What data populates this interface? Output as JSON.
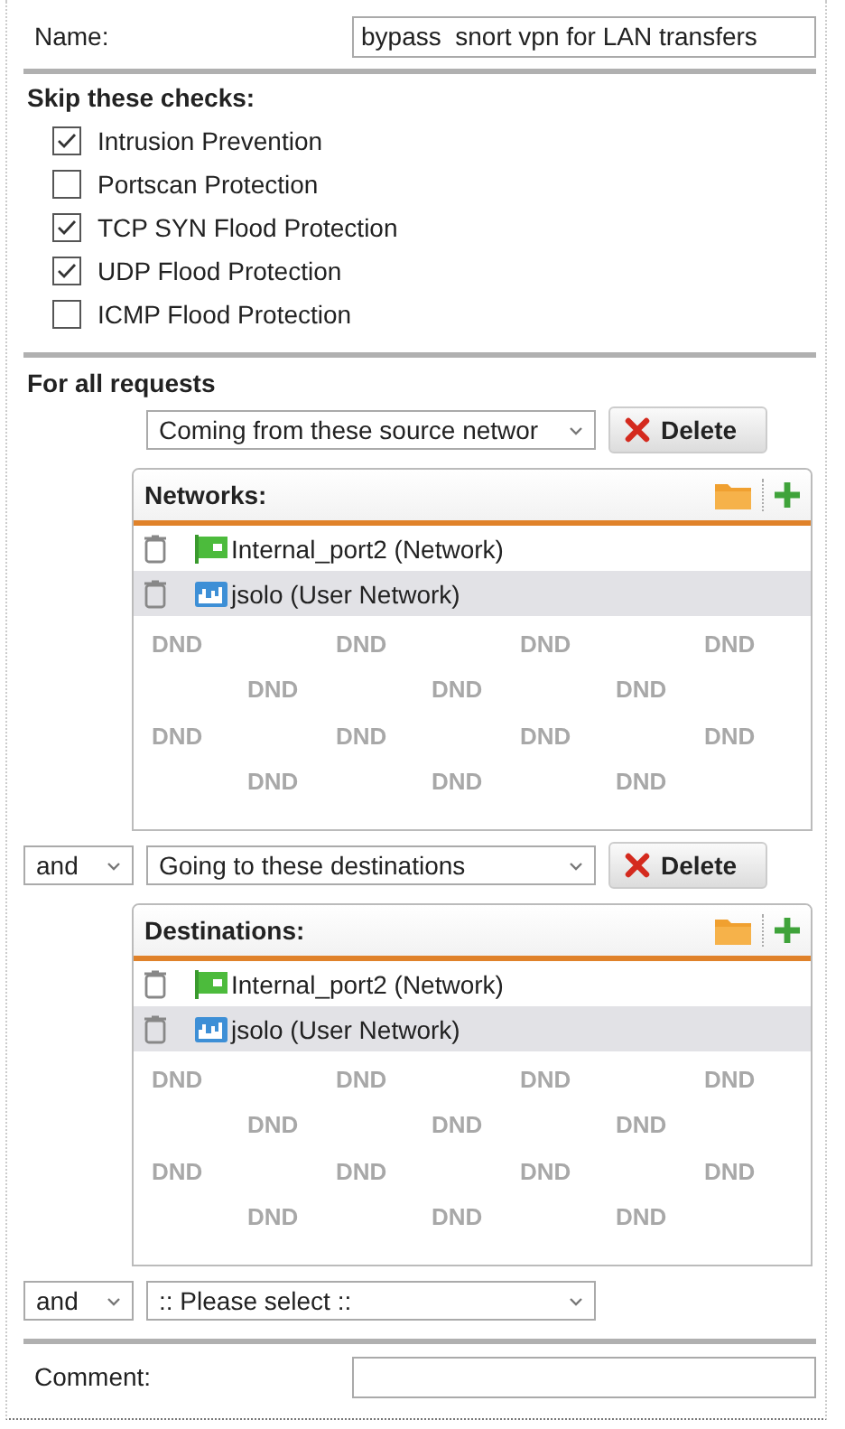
{
  "name_field": {
    "label": "Name:",
    "value": "bypass  snort vpn for LAN transfers"
  },
  "skip_checks": {
    "heading": "Skip these checks:",
    "items": [
      {
        "label": "Intrusion Prevention",
        "checked": true
      },
      {
        "label": "Portscan Protection",
        "checked": false
      },
      {
        "label": "TCP SYN Flood Protection",
        "checked": true
      },
      {
        "label": "UDP Flood Protection",
        "checked": true
      },
      {
        "label": "ICMP Flood Protection",
        "checked": false
      }
    ]
  },
  "requests": {
    "heading": "For all requests",
    "conditions": [
      {
        "kind": "list",
        "condition": "Coming from these source networ",
        "delete": "Delete",
        "list_title": "Networks:",
        "entries": [
          {
            "label": "Internal_port2 (Network)",
            "kind": "network",
            "selected": false
          },
          {
            "label": "jsolo (User Network)",
            "kind": "user",
            "selected": true
          }
        ],
        "drop_hints": [
          "DND",
          "DND",
          "DND",
          "DND",
          "DND",
          "DND",
          "DND",
          "DND",
          "DND",
          "DND",
          "DND",
          "DND",
          "DND",
          "DND"
        ]
      },
      {
        "kind": "list",
        "joiner": "and",
        "condition": "Going to these destinations",
        "delete": "Delete",
        "list_title": "Destinations:",
        "entries": [
          {
            "label": "Internal_port2 (Network)",
            "kind": "network",
            "selected": false
          },
          {
            "label": "jsolo (User Network)",
            "kind": "user",
            "selected": true
          }
        ],
        "drop_hints": [
          "DND",
          "DND",
          "DND",
          "DND",
          "DND",
          "DND",
          "DND",
          "DND",
          "DND",
          "DND",
          "DND",
          "DND",
          "DND",
          "DND"
        ]
      },
      {
        "kind": "select",
        "joiner": "and",
        "condition": ":: Please select ::"
      }
    ]
  },
  "comment_field": {
    "label": "Comment:"
  }
}
